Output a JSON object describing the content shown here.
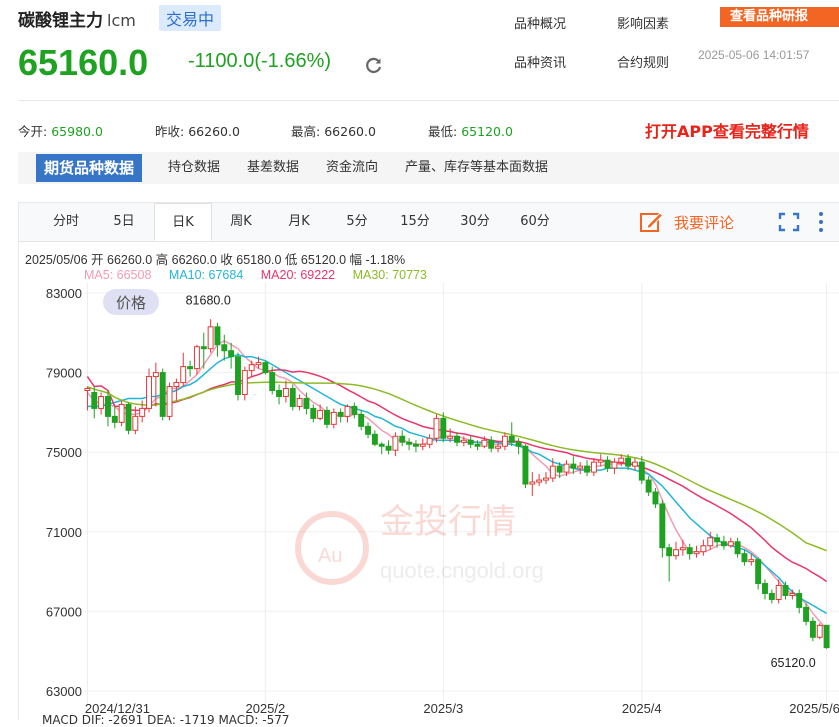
{
  "header": {
    "title": "碳酸锂主力",
    "code": "lcm",
    "status_badge": "交易中",
    "price": "65160.0",
    "change": "-1100.0(-1.66%)",
    "links": [
      "品种概况",
      "影响因素",
      "品种资讯",
      "合约规则"
    ],
    "research_button": "查看品种研报",
    "timestamp": "2025-05-06 14:01:57"
  },
  "stats": [
    {
      "label": "今开:",
      "value": "65980.0",
      "color": "#1fa121"
    },
    {
      "label": "昨收:",
      "value": "66260.0",
      "color": "#333333"
    },
    {
      "label": "最高:",
      "value": "66260.0",
      "color": "#333333"
    },
    {
      "label": "最低:",
      "value": "65120.0",
      "color": "#1fa121"
    }
  ],
  "app_note": "打开APP查看完整行情",
  "tabs": [
    "期货品种数据",
    "持仓数据",
    "基差数据",
    "资金流向",
    "产量、库存等基本面数据"
  ],
  "active_tab": 0,
  "periods": [
    "分时",
    "5日",
    "日K",
    "周K",
    "月K",
    "5分",
    "15分",
    "30分",
    "60分"
  ],
  "active_period": 2,
  "comment_label": "我要评论",
  "ohlc_line": "2025/05/06  开 66260.0  高 66260.0  收 65180.0  低 65120.0  幅 -1.18%",
  "ma": [
    {
      "label": "MA5: 66508",
      "color": "#f29bb3"
    },
    {
      "label": "MA10: 67684",
      "color": "#21b6d8"
    },
    {
      "label": "MA20: 69222",
      "color": "#e8356b"
    },
    {
      "label": "MA30: 70773",
      "color": "#8cbb26"
    }
  ],
  "macd_line": "MACD  DIF: -2691    DEA: -1719    MACD: -577",
  "watermark": {
    "text": "金投行情",
    "url": "quote.cngold.org"
  },
  "colors": {
    "up": "#e43838",
    "down": "#1fa121",
    "accent": "#3776c6",
    "orange": "#f26522"
  },
  "chart_data": {
    "type": "candlestick",
    "price_label": "价格",
    "y_ticks": [
      83000,
      79000,
      75000,
      71000,
      67000,
      63000
    ],
    "ylim": [
      63000,
      83000
    ],
    "x_ticks": [
      "2024/12/31",
      "2025/2",
      "2025/3",
      "2025/4",
      "2025/5/6"
    ],
    "x_tick_index": [
      0,
      26,
      52,
      81,
      108
    ],
    "max_label": "81680.0",
    "max_index": 18,
    "last_label": "65120.0",
    "candles": [
      [
        78100,
        78200,
        77100,
        78300
      ],
      [
        78000,
        77200,
        76700,
        78300
      ],
      [
        77200,
        77800,
        76900,
        78000
      ],
      [
        77800,
        76800,
        76300,
        78100
      ],
      [
        76800,
        76500,
        76200,
        77300
      ],
      [
        76500,
        77400,
        76300,
        77600
      ],
      [
        77400,
        76100,
        75900,
        77500
      ],
      [
        76100,
        76800,
        75900,
        77300
      ],
      [
        76800,
        77200,
        76500,
        77600
      ],
      [
        77200,
        78800,
        77000,
        79200
      ],
      [
        78800,
        79000,
        77300,
        79500
      ],
      [
        79000,
        76800,
        76600,
        79200
      ],
      [
        76800,
        78300,
        76600,
        78500
      ],
      [
        78300,
        78500,
        77600,
        78700
      ],
      [
        78500,
        79300,
        78300,
        80000
      ],
      [
        79300,
        79200,
        78800,
        79600
      ],
      [
        79200,
        80300,
        78900,
        80400
      ],
      [
        80300,
        80200,
        79200,
        81000
      ],
      [
        80200,
        81300,
        80000,
        81680
      ],
      [
        81300,
        80400,
        79800,
        81500
      ],
      [
        80400,
        80100,
        79600,
        80900
      ],
      [
        80100,
        79800,
        79200,
        80500
      ],
      [
        79800,
        77900,
        77600,
        80000
      ],
      [
        77900,
        79100,
        77600,
        79300
      ],
      [
        79100,
        79400,
        78800,
        79600
      ],
      [
        79400,
        79500,
        79200,
        79800
      ],
      [
        79500,
        79000,
        78900,
        79600
      ],
      [
        79000,
        78100,
        77900,
        79300
      ],
      [
        78100,
        77800,
        77400,
        78400
      ],
      [
        77800,
        78200,
        77500,
        78600
      ],
      [
        78200,
        77300,
        77100,
        78400
      ],
      [
        77300,
        77700,
        77100,
        77900
      ],
      [
        77700,
        77200,
        76900,
        78000
      ],
      [
        77200,
        76700,
        76500,
        77400
      ],
      [
        76700,
        77100,
        76600,
        77400
      ],
      [
        77100,
        76400,
        76200,
        77300
      ],
      [
        76400,
        77000,
        76200,
        77200
      ],
      [
        77000,
        76800,
        76500,
        77200
      ],
      [
        76800,
        77300,
        76500,
        77400
      ],
      [
        77300,
        76900,
        76700,
        77500
      ],
      [
        76900,
        76300,
        76100,
        77100
      ],
      [
        76300,
        75900,
        75700,
        76500
      ],
      [
        75900,
        75400,
        75300,
        76100
      ],
      [
        75400,
        75300,
        74900,
        75500
      ],
      [
        75300,
        75100,
        74900,
        75600
      ],
      [
        75100,
        75800,
        74800,
        76000
      ],
      [
        75800,
        75500,
        75300,
        76100
      ],
      [
        75500,
        75400,
        75100,
        75700
      ],
      [
        75400,
        75300,
        75000,
        75600
      ],
      [
        75300,
        75400,
        75100,
        75700
      ],
      [
        75400,
        75700,
        75200,
        75900
      ],
      [
        75700,
        76700,
        75500,
        76900
      ],
      [
        76700,
        75700,
        75500,
        77000
      ],
      [
        75700,
        75800,
        75500,
        76200
      ],
      [
        75800,
        75500,
        75300,
        76000
      ],
      [
        75500,
        75600,
        75300,
        75800
      ],
      [
        75600,
        75400,
        75200,
        75800
      ],
      [
        75400,
        75300,
        75100,
        75600
      ],
      [
        75300,
        75600,
        75200,
        75800
      ],
      [
        75600,
        75200,
        75000,
        75800
      ],
      [
        75200,
        75300,
        75000,
        75500
      ],
      [
        75300,
        75800,
        75100,
        76000
      ],
      [
        75800,
        75500,
        75300,
        76500
      ],
      [
        75500,
        75300,
        74900,
        75700
      ],
      [
        75300,
        73400,
        73200,
        75400
      ],
      [
        73400,
        73500,
        72800,
        74000
      ],
      [
        73500,
        73600,
        73300,
        73900
      ],
      [
        73600,
        73700,
        73400,
        74000
      ],
      [
        73700,
        74300,
        73500,
        74700
      ],
      [
        74300,
        74000,
        73700,
        74500
      ],
      [
        74000,
        74400,
        73800,
        74600
      ],
      [
        74400,
        74200,
        73900,
        74800
      ],
      [
        74200,
        74300,
        73900,
        74500
      ],
      [
        74300,
        74000,
        73800,
        74600
      ],
      [
        74000,
        74500,
        73800,
        74700
      ],
      [
        74500,
        74600,
        74300,
        74900
      ],
      [
        74600,
        74200,
        74000,
        74800
      ],
      [
        74200,
        74500,
        73900,
        74700
      ],
      [
        74500,
        74700,
        74300,
        74900
      ],
      [
        74700,
        74300,
        74100,
        74900
      ],
      [
        74300,
        74500,
        74100,
        74700
      ],
      [
        74500,
        73600,
        73400,
        74800
      ],
      [
        73600,
        73000,
        72800,
        73800
      ],
      [
        73000,
        72400,
        72200,
        73200
      ],
      [
        72400,
        70200,
        69700,
        72600
      ],
      [
        70200,
        69800,
        68500,
        70400
      ],
      [
        69800,
        70100,
        69600,
        70500
      ],
      [
        70100,
        70200,
        69800,
        70600
      ],
      [
        70200,
        69900,
        69600,
        70400
      ],
      [
        69900,
        70000,
        69700,
        70300
      ],
      [
        70000,
        70300,
        69800,
        70600
      ],
      [
        70300,
        70700,
        70100,
        71000
      ],
      [
        70700,
        70500,
        70200,
        70900
      ],
      [
        70500,
        70300,
        70100,
        70800
      ],
      [
        70300,
        70500,
        70200,
        70700
      ],
      [
        70500,
        69900,
        69700,
        70700
      ],
      [
        69900,
        69500,
        69300,
        70100
      ],
      [
        69500,
        69600,
        69300,
        69900
      ],
      [
        69600,
        68400,
        68100,
        69700
      ],
      [
        68400,
        67900,
        67600,
        68600
      ],
      [
        67900,
        67600,
        67400,
        68100
      ],
      [
        67600,
        68300,
        67400,
        68600
      ],
      [
        68300,
        67800,
        67600,
        68500
      ],
      [
        67800,
        67900,
        67600,
        68100
      ],
      [
        67900,
        67200,
        66900,
        68100
      ],
      [
        67200,
        66500,
        66300,
        67400
      ],
      [
        66500,
        65700,
        65500,
        66700
      ],
      [
        65700,
        66300,
        65600,
        66400
      ],
      [
        66300,
        65180,
        65120,
        66260
      ]
    ],
    "ma5": [
      78000,
      77600,
      77400,
      77400,
      77300,
      77000,
      76900,
      76900,
      77000,
      77300,
      77700,
      77800,
      78200,
      78200,
      78300,
      78600,
      78900,
      79400,
      79900,
      80400,
      80600,
      80400,
      80200,
      79800,
      79500,
      79200,
      79100,
      79000,
      78800,
      78700,
      78500,
      78100,
      77800,
      77500,
      77300,
      77000,
      76900,
      76800,
      76800,
      76900,
      76900,
      76700,
      76400,
      76100,
      75900,
      75600,
      75600,
      75500,
      75400,
      75400,
      75500,
      75700,
      75800,
      75800,
      75800,
      75700,
      75600,
      75500,
      75400,
      75400,
      75400,
      75400,
      75500,
      75500,
      75200,
      74900,
      74600,
      74300,
      73900,
      73800,
      73900,
      74000,
      74100,
      74200,
      74300,
      74300,
      74400,
      74400,
      74400,
      74500,
      74400,
      74200,
      73900,
      73400,
      72600,
      71800,
      71100,
      70500,
      70000,
      70000,
      70000,
      70100,
      70300,
      70400,
      70400,
      70400,
      70200,
      70000,
      69700,
      69300,
      68900,
      68500,
      68100,
      67900,
      67700,
      67400,
      66900,
      66500,
      66100
    ]
  },
  "chart_ma": {
    "ma10": [
      77300,
      77300,
      77300,
      77400,
      77500,
      77600,
      77700,
      77700,
      77700,
      77800,
      77800,
      77900,
      78000,
      78100,
      78300,
      78400,
      78600,
      78900,
      79200,
      79500,
      79700,
      79800,
      79900,
      79800,
      79800,
      79700,
      79600,
      79400,
      79200,
      79000,
      78800,
      78600,
      78400,
      78200,
      78000,
      77800,
      77600,
      77400,
      77300,
      77200,
      77100,
      77000,
      76800,
      76700,
      76500,
      76300,
      76200,
      76000,
      75900,
      75800,
      75700,
      75600,
      75600,
      75600,
      75600,
      75500,
      75500,
      75500,
      75500,
      75500,
      75500,
      75400,
      75400,
      75300,
      75200,
      75000,
      74900,
      74700,
      74500,
      74400,
      74300,
      74200,
      74100,
      74100,
      74100,
      74100,
      74200,
      74200,
      74200,
      74200,
      74100,
      74000,
      73900,
      73600,
      73300,
      72900,
      72500,
      72100,
      71700,
      71400,
      71100,
      70800,
      70600,
      70400,
      70300,
      70200,
      70100,
      69900,
      69600,
      69300,
      69000,
      68700,
      68300,
      68000,
      67700,
      67500,
      67300,
      67100,
      66900
    ]
  }
}
